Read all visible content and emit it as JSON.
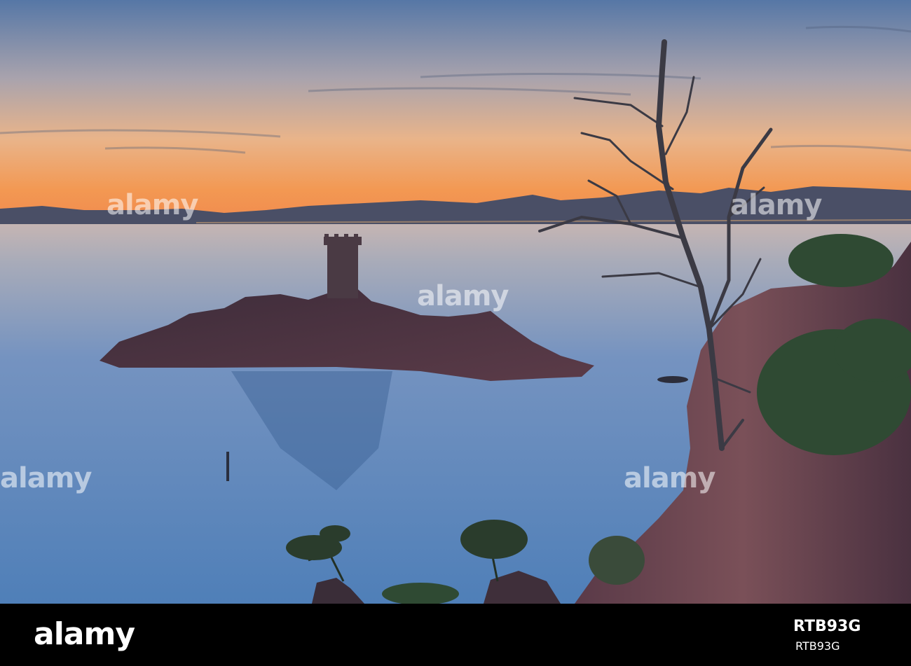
{
  "watermark": {
    "text": "alamy"
  },
  "footer": {
    "brand": "alamy",
    "image_id": "RTB93G",
    "id_small": "RTB93G"
  },
  "colors": {
    "sky_top": "#5a79a8",
    "sky_mid": "#c0a59a",
    "sky_horizon": "#f0934d",
    "sea": "#5f87b8",
    "rock": "#4a3340",
    "footer_bg": "#000000"
  }
}
